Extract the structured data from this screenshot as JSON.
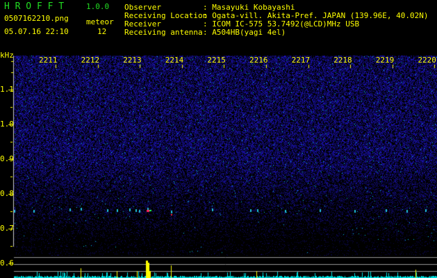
{
  "app": {
    "title": "H R O F F T",
    "version": "1.0.0"
  },
  "file": {
    "name": "0507162210.png",
    "datetime": "05.07.16 22:10"
  },
  "meteor": {
    "label": "meteor",
    "count": "12"
  },
  "info": [
    {
      "key": "Observer",
      "value": ": Masayuki Kobayashi"
    },
    {
      "key": "Receiving Location",
      "value": ": Ogata-vill. Akita-Pref. JAPAN (139.96E, 40.02N)"
    },
    {
      "key": "Receiver",
      "value": ": ICOM IC-575 53.7492(@LCD)MHz USB"
    },
    {
      "key": "Receiving antenna",
      "value": ": A504HB(yagi 4el)"
    }
  ],
  "axis": {
    "unit": "kHz",
    "y_ticks": [
      "1.1",
      "1.0",
      "0.9",
      "0.8",
      "0.7",
      "0.6"
    ],
    "x_ticks": [
      "2211",
      "2212",
      "2213",
      "2214",
      "2215",
      "2216",
      "2217",
      "2218",
      "2219",
      "2220"
    ]
  },
  "colors": {
    "text": "#ffff00",
    "title": "#22dd22",
    "noise": "#2020c0",
    "level": "#00e0e0"
  }
}
